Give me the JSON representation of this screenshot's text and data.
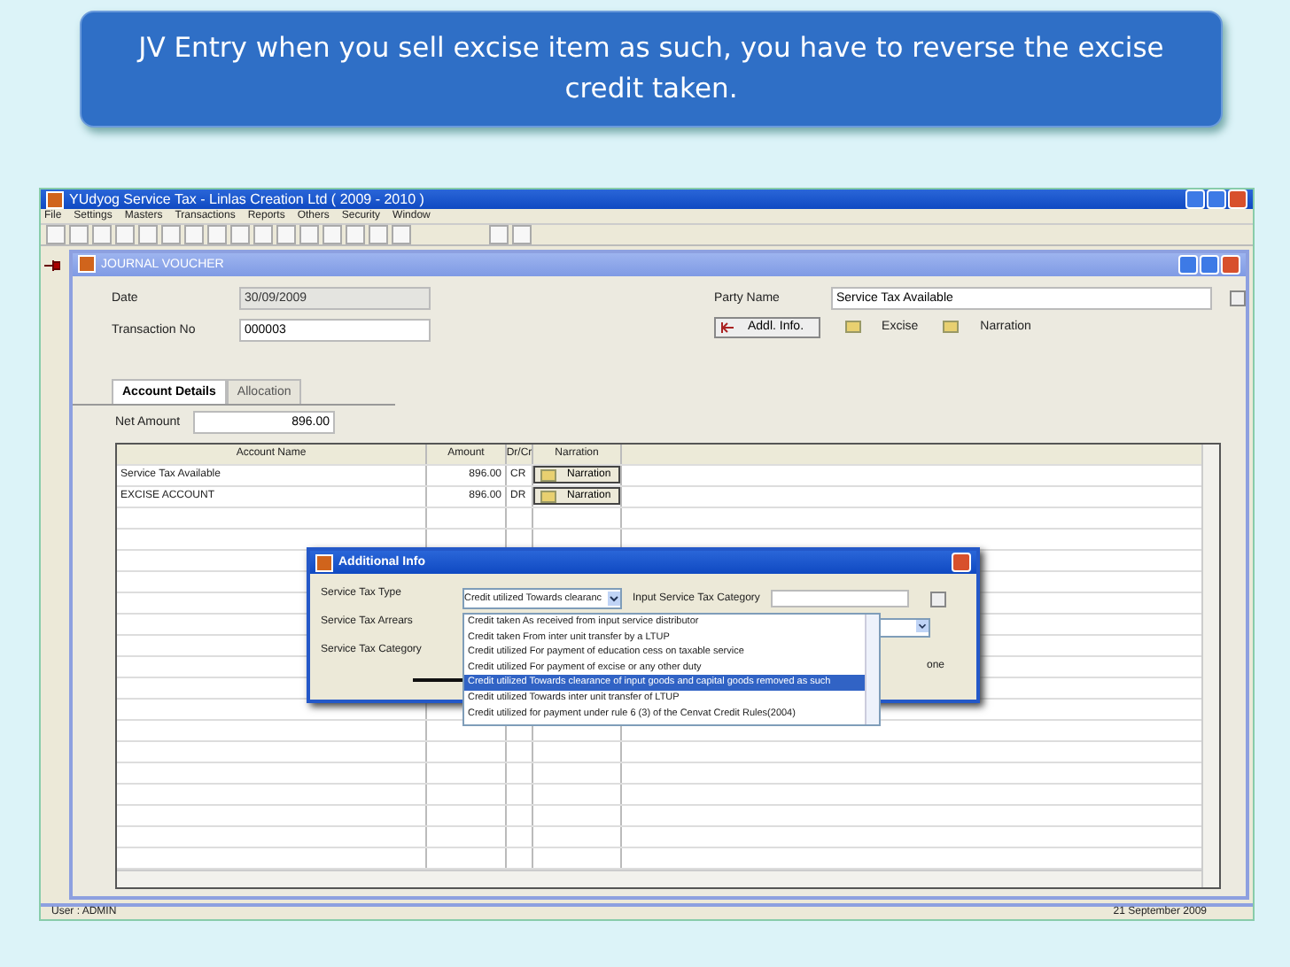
{
  "slide_title": "JV Entry when you sell excise item as such, you have to reverse the excise credit taken.",
  "app": {
    "title": "YUdyog Service Tax - Linlas Creation Ltd ( 2009 - 2010 )",
    "menu": [
      "File",
      "Settings",
      "Masters",
      "Transactions",
      "Reports",
      "Others",
      "Security",
      "Window"
    ]
  },
  "voucher": {
    "title": "JOURNAL VOUCHER",
    "fields": [
      {
        "label": "Date",
        "value": "30/09/2009",
        "disabled": true
      },
      {
        "label": "Transaction No",
        "value": "000003",
        "disabled": false
      }
    ],
    "party": {
      "label": "Party Name",
      "value": "Service Tax Available"
    },
    "actions": [
      {
        "label": "Addl. Info.",
        "kind": "button"
      },
      {
        "label": "Excise",
        "kind": "link"
      },
      {
        "label": "Narration",
        "kind": "link"
      }
    ]
  },
  "tabs": [
    {
      "label": "Account Details",
      "selected": true
    },
    {
      "label": "Allocation",
      "selected": false
    }
  ],
  "net_amount": {
    "label": "Net Amount",
    "value": "896.00"
  },
  "table": {
    "columns": [
      "Account Name",
      "Amount",
      "Dr/Cr",
      "Narration"
    ],
    "rows": [
      {
        "account": "Service Tax Available",
        "amount": "896.00",
        "drcr": "CR",
        "narration": "Narration"
      },
      {
        "account": "EXCISE ACCOUNT",
        "amount": "896.00",
        "drcr": "DR",
        "narration": "Narration"
      }
    ]
  },
  "dialog": {
    "title": "Additional Info",
    "labels": [
      "Service Tax Type",
      "Service Tax Arrears",
      "Service Tax Category"
    ],
    "type_value": "Credit utilized Towards clearanc",
    "category_label": "Input Service Tax Category",
    "trailing_text": "one",
    "options": [
      {
        "label": "Credit taken As received from input service distributor",
        "selected": false
      },
      {
        "label": "Credit taken From inter unit transfer by a LTUP",
        "selected": false
      },
      {
        "label": "Credit utilized For payment of education cess on taxable service",
        "selected": false
      },
      {
        "label": "Credit utilized For payment of excise or any other duty",
        "selected": false
      },
      {
        "label": "Credit utilized Towards clearance of input goods and capital goods removed as such",
        "selected": true
      },
      {
        "label": "Credit utilized Towards inter unit transfer of LTUP",
        "selected": false
      },
      {
        "label": "Credit utilized for payment under rule 6 (3) of the Cenvat Credit Rules(2004)",
        "selected": false
      }
    ]
  },
  "status_bar": {
    "user": "User : ADMIN",
    "date": "21 September 2009"
  }
}
